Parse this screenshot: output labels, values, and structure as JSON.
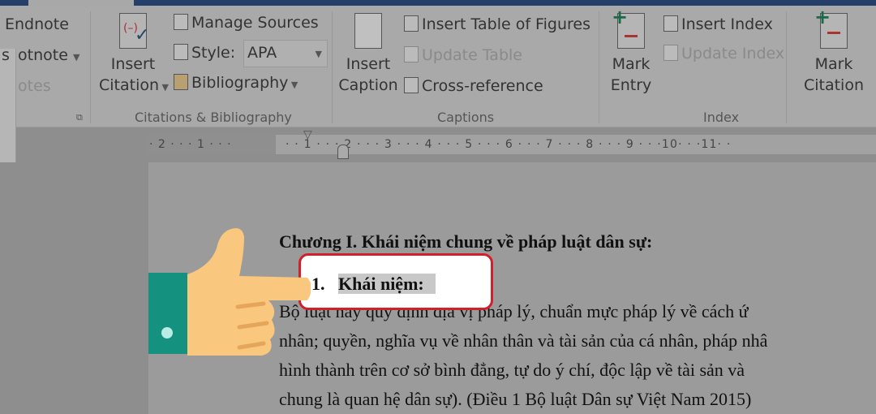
{
  "ribbon": {
    "footnotes": {
      "endnote": "Endnote",
      "footnote": "otnote",
      "group": "otes",
      "prefix": "s"
    },
    "citations": {
      "insert_citation": [
        "Insert",
        "Citation"
      ],
      "manage_sources": "Manage Sources",
      "style_label": "Style:",
      "style_value": "APA",
      "bibliography": "Bibliography",
      "group": "Citations & Bibliography"
    },
    "captions": {
      "insert_caption": [
        "Insert",
        "Caption"
      ],
      "insert_table_of_figures": "Insert Table of Figures",
      "update_table": "Update Table",
      "cross_reference": "Cross-reference",
      "group": "Captions"
    },
    "index": {
      "mark_entry": [
        "Mark",
        "Entry"
      ],
      "insert_index": "Insert Index",
      "update_index": "Update Index",
      "group": "Index"
    },
    "toa": {
      "mark_citation": [
        "Mark",
        "Citation"
      ]
    }
  },
  "ruler": {
    "left": "· 2 · · · 1 · · ·",
    "main": "· · 1 · · · 2 · · · 3 · · · 4 · · · 5 · · · 6 · · · 7 · · · 8 · · · 9 · · ·10· · ·11· ·"
  },
  "document": {
    "heading": "Chương I. Khái niệm chung về pháp luật dân sự:",
    "subheading_number": "1.",
    "subheading": "Khái niệm:",
    "lines": [
      "Bộ luật này quy định địa vị pháp lý, chuẩn mực pháp lý về cách ứ",
      "nhân; quyền, nghĩa vụ về nhân thân và tài sản của cá nhân, pháp nhâ",
      "hình thành trên cơ sở bình đẳng, tự do ý chí, độc lập về tài sản và",
      "chung là quan hệ dân sự). (Điều 1 Bộ luật Dân sự Việt Nam 2015)"
    ]
  },
  "colors": {
    "highlight_border": "#d0202a",
    "hand": "#f9c77e",
    "cuff": "#14917f"
  }
}
